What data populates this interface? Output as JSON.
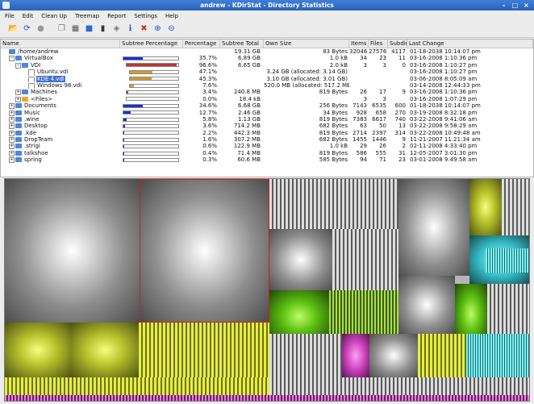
{
  "window": {
    "title": "andrew - KDirStat - Directory Statistics"
  },
  "menu": [
    "File",
    "Edit",
    "Clean Up",
    "Treemap",
    "Report",
    "Settings",
    "Help"
  ],
  "columns": [
    "Name",
    "Subtree Percentage",
    "Percentage",
    "Subtree Total",
    "Own Size",
    "Items",
    "Files",
    "Subdirs",
    "Last Change"
  ],
  "rows": [
    {
      "name": "/home/andrew",
      "level": 0,
      "icon": "folder-open-icon",
      "twisty": "",
      "bar": 0,
      "barColor": "",
      "pct": "",
      "subtree": "19.31 GB",
      "own": "83 Bytes",
      "items": "32046",
      "files": "27576",
      "subdirs": "4117",
      "last": "01-18-2038 10:14:07 pm"
    },
    {
      "name": "VirtualBox",
      "level": 1,
      "icon": "folder-icon",
      "twisty": "−",
      "bar": 0.357,
      "barColor": "#1a2fd6",
      "pct": "35.7%",
      "subtree": "6.89 GB",
      "own": "1.0 kB",
      "items": "34",
      "files": "23",
      "subdirs": "11",
      "last": "03-16-2008 1:10:36 pm"
    },
    {
      "name": "VDI",
      "level": 2,
      "icon": "folder-icon",
      "twisty": "−",
      "bar": 0.968,
      "barColor": "#c03232",
      "pct": "96.6%",
      "subtree": "6.65 GB",
      "own": "2.0 kB",
      "items": "3",
      "files": "3",
      "subdirs": "0",
      "last": "03-16-2008 1:10:27 pm"
    },
    {
      "name": "Ubuntu.vdi",
      "level": 3,
      "icon": "file-icon",
      "twisty": "",
      "bar": 0.471,
      "barColor": "#d29b2a",
      "pct": "47.1%",
      "subtree": "",
      "own": "3.24 GB (allocated: 3.14 GB)",
      "items": "",
      "files": "",
      "subdirs": "",
      "last": "03-16-2008 1:10:27 pm"
    },
    {
      "name": "KDE 4.vdi",
      "level": 3,
      "icon": "file-icon",
      "twisty": "",
      "bar": 0.453,
      "barColor": "#d29b2a",
      "pct": "45.3%",
      "subtree": "",
      "own": "3.10 GB (allocated: 3.01 GB)",
      "items": "",
      "files": "",
      "subdirs": "",
      "last": "03-06-2008 8:05:09 am",
      "selected": true
    },
    {
      "name": "Windows 98.vdi",
      "level": 3,
      "icon": "file-icon",
      "twisty": "",
      "bar": 0.076,
      "barColor": "#d29b2a",
      "pct": "7.6%",
      "subtree": "",
      "own": "520.0 MB (allocated: 517.2 MB)",
      "items": "",
      "files": "",
      "subdirs": "",
      "last": "03-14-2008 12:44:33 pm"
    },
    {
      "name": "Machines",
      "level": 2,
      "icon": "folder-icon",
      "twisty": "+",
      "bar": 0.034,
      "barColor": "#c03232",
      "pct": "3.4%",
      "subtree": "240.8 MB",
      "own": "819 Bytes",
      "items": "26",
      "files": "17",
      "subdirs": "9",
      "last": "03-16-2008 1:10:36 pm"
    },
    {
      "name": "<Files>",
      "level": 2,
      "icon": "folder-files-icon",
      "twisty": "+",
      "bar": 0,
      "barColor": "#c03232",
      "pct": "0.0%",
      "subtree": "18.4 kB",
      "own": "",
      "items": "3",
      "files": "3",
      "subdirs": "",
      "last": "03-16-2008 1:07:29 pm"
    },
    {
      "name": "Documents",
      "level": 1,
      "icon": "folder-icon",
      "twisty": "+",
      "bar": 0.346,
      "barColor": "#1a2fd6",
      "pct": "34.6%",
      "subtree": "6.68 GB",
      "own": "256 Bytes",
      "items": "7143",
      "files": "6535",
      "subdirs": "600",
      "last": "01-18-2038 10:14:07 pm"
    },
    {
      "name": "Music",
      "level": 1,
      "icon": "folder-icon",
      "twisty": "+",
      "bar": 0.127,
      "barColor": "#1a2fd6",
      "pct": "12.7%",
      "subtree": "2.46 GB",
      "own": "34 Bytes",
      "items": "928",
      "files": "658",
      "subdirs": "270",
      "last": "03-19-2008 8:32:18 pm"
    },
    {
      "name": ".wine",
      "level": 1,
      "icon": "folder-icon",
      "twisty": "+",
      "bar": 0.058,
      "barColor": "#1a2fd6",
      "pct": "5.8%",
      "subtree": "1.13 GB",
      "own": "819 Bytes",
      "items": "7383",
      "files": "6617",
      "subdirs": "740",
      "last": "03-22-2008 9:41:06 am"
    },
    {
      "name": "Desktop",
      "level": 1,
      "icon": "folder-icon",
      "twisty": "+",
      "bar": 0.036,
      "barColor": "#1a2fd6",
      "pct": "3.6%",
      "subtree": "714.2 MB",
      "own": "682 Bytes",
      "items": "63",
      "files": "50",
      "subdirs": "13",
      "last": "03-22-2008 9:58:29 am"
    },
    {
      "name": ".kde",
      "level": 1,
      "icon": "folder-icon",
      "twisty": "+",
      "bar": 0.022,
      "barColor": "#1a2fd6",
      "pct": "2.2%",
      "subtree": "442.3 MB",
      "own": "819 Bytes",
      "items": "2714",
      "files": "2397",
      "subdirs": "314",
      "last": "03-22-2008 10:49:48 am"
    },
    {
      "name": "DropTeam",
      "level": 1,
      "icon": "folder-icon",
      "twisty": "+",
      "bar": 0.016,
      "barColor": "#1a2fd6",
      "pct": "1.6%",
      "subtree": "307.2 MB",
      "own": "682 Bytes",
      "items": "1455",
      "files": "1446",
      "subdirs": "9",
      "last": "11-21-2007 11:21:34 am"
    },
    {
      "name": ".strigi",
      "level": 1,
      "icon": "folder-icon",
      "twisty": "+",
      "bar": 0.006,
      "barColor": "#1a2fd6",
      "pct": "0.6%",
      "subtree": "122.9 MB",
      "own": "1.0 kB",
      "items": "29",
      "files": "26",
      "subdirs": "2",
      "last": "02-11-2008 4:33:40 pm"
    },
    {
      "name": "talkshoe",
      "level": 1,
      "icon": "folder-icon",
      "twisty": "+",
      "bar": 0.004,
      "barColor": "#1a2fd6",
      "pct": "0.4%",
      "subtree": "71.4 MB",
      "own": "819 Bytes",
      "items": "586",
      "files": "555",
      "subdirs": "31",
      "last": "12-05-2007 3:01:30 pm"
    },
    {
      "name": "spring",
      "level": 1,
      "icon": "folder-icon",
      "twisty": "+",
      "bar": 0.003,
      "barColor": "#1a2fd6",
      "pct": "0.3%",
      "subtree": "60.6 MB",
      "own": "585 Bytes",
      "items": "94",
      "files": "71",
      "subdirs": "23",
      "last": "03-01-2008 9:49:58 am"
    }
  ]
}
